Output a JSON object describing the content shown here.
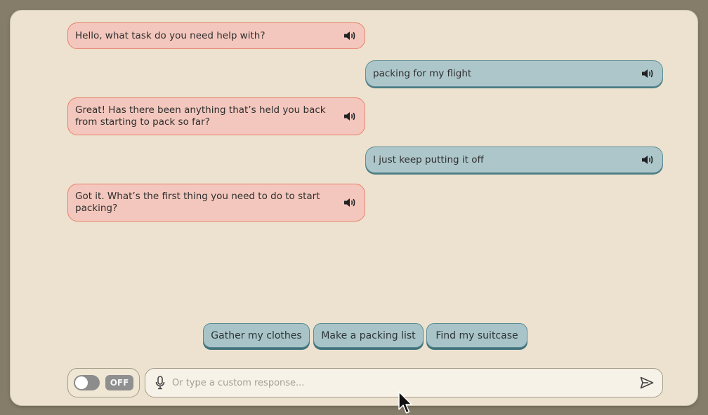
{
  "messages": [
    {
      "role": "bot",
      "text": "Hello, what task do you need help with?"
    },
    {
      "role": "user",
      "text": "packing for my flight"
    },
    {
      "role": "bot",
      "text": "Great! Has there been anything that’s held you back from starting to pack so far?"
    },
    {
      "role": "user",
      "text": "I just keep putting it off"
    },
    {
      "role": "bot",
      "text": "Got it. What’s the first thing you need to do to start packing?"
    }
  ],
  "suggestions": [
    "Gather my clothes",
    "Make a packing list",
    "Find my suitcase"
  ],
  "toggle": {
    "state_label": "OFF"
  },
  "input": {
    "value": "",
    "placeholder": "Or type a custom response..."
  },
  "icons": {
    "speaker": "speaker-icon",
    "microphone": "microphone-icon",
    "send": "send-icon"
  },
  "colors": {
    "bot_bubble": "#f3c7bd",
    "bot_border": "#e8826c",
    "user_bubble": "#adc6ca",
    "user_border": "#5f8e95",
    "background": "#ece2cf"
  }
}
